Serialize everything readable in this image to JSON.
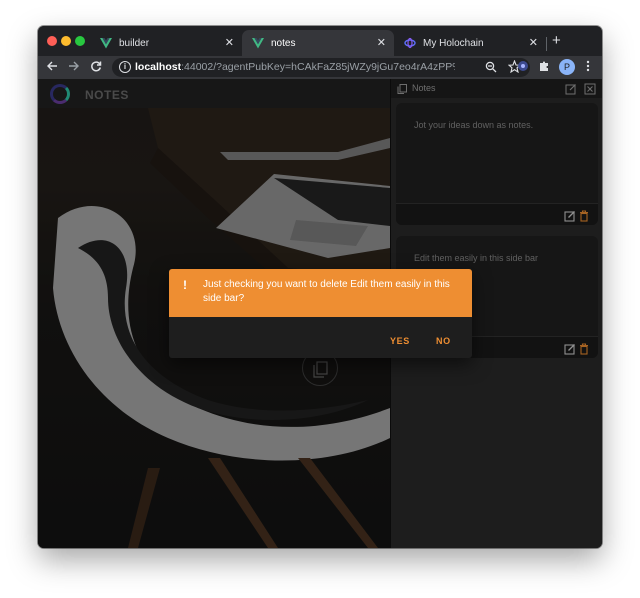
{
  "browser": {
    "tabs": [
      {
        "title": "builder",
        "favicon": "vue-logo-icon",
        "active": false
      },
      {
        "title": "notes",
        "favicon": "vue-logo-icon",
        "active": true
      },
      {
        "title": "My Holochain",
        "favicon": "holochain-icon",
        "active": false
      }
    ],
    "tab_close": "✕",
    "new_tab": "+",
    "address": {
      "host": "localhost",
      "rest": ":44002/?agentPubKey=hCAkFaZ85jWZy9jGu7eo4rA4zPP%2B..."
    },
    "profile_initial": "P"
  },
  "app": {
    "title": "NOTES"
  },
  "sidebar": {
    "label": "Notes",
    "notes": [
      {
        "text": "Jot your ideas down as notes."
      },
      {
        "text": "Edit them easily in this side bar"
      }
    ]
  },
  "dialog": {
    "icon": "!",
    "message": "Just checking you want to delete Edit them easily in this side bar?",
    "yes_label": "YES",
    "no_label": "NO"
  },
  "colors": {
    "accent": "#ee8e32",
    "vue_green": "#41b883",
    "window_chrome": "#202124"
  }
}
